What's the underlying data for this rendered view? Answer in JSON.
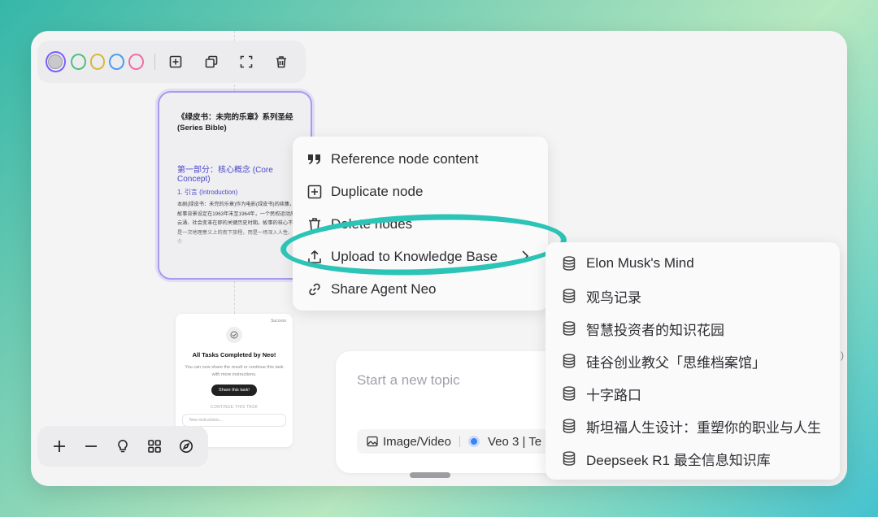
{
  "toolbar": {
    "swatches": [
      {
        "name": "gray",
        "color": "#b8b8bd",
        "selected": true
      },
      {
        "name": "green",
        "color": "#4fbf7f"
      },
      {
        "name": "yellow",
        "color": "#d9b63a"
      },
      {
        "name": "blue",
        "color": "#4a9bf0"
      },
      {
        "name": "pink",
        "color": "#ec6fa5"
      }
    ],
    "icons": [
      "add-box-icon",
      "copy-icon",
      "fullscreen-icon",
      "trash-icon"
    ]
  },
  "doc_card": {
    "title": "《绿皮书：未完的乐章》系列圣经 (Series Bible)",
    "section": "第一部分：核心概念 (Core Concept)",
    "subsection": "1. 引言 (Introduction)",
    "body": "本剧(绿皮书：未完的乐章)作为电影(绿皮书)的续集，将故事背景设定在1963年末至1964年，一个民权运动风起云涌、社会变革在即的关键历史时期。故事的核心不再是一次地理意义上的南下旅程，而是一场深入人性、社会"
  },
  "task_card": {
    "badge": "Success",
    "title": "All Tasks Completed by Neo!",
    "desc": "You can now share the result or continue this task with more instructions.",
    "share_label": "Share this task!",
    "continue_label": "CONTINUE THIS TASK",
    "input_placeholder": "New instructions..."
  },
  "bottom_tools": [
    "plus-icon",
    "minus-icon",
    "lightbulb-icon",
    "grid-icon",
    "compass-icon"
  ],
  "composer": {
    "placeholder": "Start a new topic",
    "chip_media": "Image/Video",
    "chip_model": "Veo 3 | Te"
  },
  "context_menu": {
    "items": [
      {
        "label": "Reference node content",
        "icon": "quote-icon"
      },
      {
        "label": "Duplicate node",
        "icon": "add-box-icon"
      },
      {
        "label": "Delete nodes",
        "icon": "trash-icon"
      },
      {
        "label": "Upload to Knowledge Base",
        "icon": "upload-icon"
      },
      {
        "label": "Share Agent Neo",
        "icon": "link-icon"
      }
    ]
  },
  "knowledge_bases": {
    "items": [
      "Elon Musk's Mind",
      "观鸟记录",
      "智慧投资者的知识花园",
      "硅谷创业教父「思维档案馆」",
      "十字路口",
      "斯坦福人生设计：重塑你的职业与人生",
      "Deepseek R1 最全信息知识库"
    ]
  },
  "colors": {
    "accent": "#7c5cff",
    "highlight": "#2bc4b6",
    "heading_blue": "#4a47c9"
  }
}
